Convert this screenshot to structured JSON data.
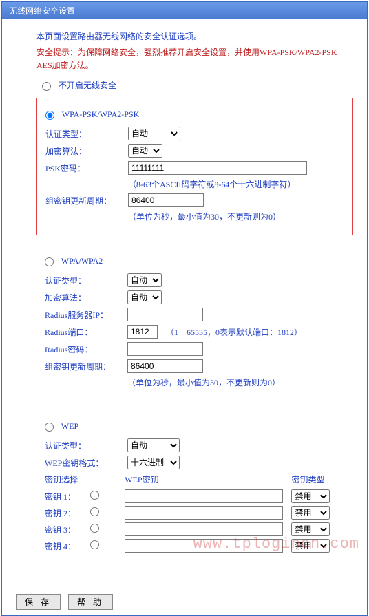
{
  "title": "无线网络安全设置",
  "intro": "本页面设置路由器无线网络的安全认证选项。",
  "warning": "安全提示：为保障网络安全，强烈推荐开启安全设置，并使用WPA-PSK/WPA2-PSK AES加密方法。",
  "disable_label": "不开启无线安全",
  "wpa_psk": {
    "title": "WPA-PSK/WPA2-PSK",
    "auth_label": "认证类型：",
    "auth_value": "自动",
    "enc_label": "加密算法：",
    "enc_value": "自动",
    "psk_label": "PSK密码：",
    "psk_value": "11111111",
    "psk_hint": "（8-63个ASCII码字符或8-64个十六进制字符）",
    "rekey_label": "组密钥更新周期：",
    "rekey_value": "86400",
    "rekey_hint": "（单位为秒，最小值为30，不更新则为0）"
  },
  "wpa": {
    "title": "WPA/WPA2",
    "auth_label": "认证类型：",
    "auth_value": "自动",
    "enc_label": "加密算法：",
    "enc_value": "自动",
    "radius_ip_label": "Radius服务器IP：",
    "radius_ip_value": "",
    "radius_port_label": "Radius端口：",
    "radius_port_value": "1812",
    "radius_port_hint": "（1－65535，0表示默认端口：1812）",
    "radius_pw_label": "Radius密码：",
    "radius_pw_value": "",
    "rekey_label": "组密钥更新周期：",
    "rekey_value": "86400",
    "rekey_hint": "（单位为秒，最小值为30，不更新则为0）"
  },
  "wep": {
    "title": "WEP",
    "auth_label": "认证类型：",
    "auth_value": "自动",
    "fmt_label": "WEP密钥格式：",
    "fmt_value": "十六进制",
    "col_select": "密钥选择",
    "col_key": "WEP密钥",
    "col_type": "密钥类型",
    "keys": [
      {
        "label": "密钥 1：",
        "value": "",
        "type": "禁用"
      },
      {
        "label": "密钥 2：",
        "value": "",
        "type": "禁用"
      },
      {
        "label": "密钥 3：",
        "value": "",
        "type": "禁用"
      },
      {
        "label": "密钥 4：",
        "value": "",
        "type": "禁用"
      }
    ]
  },
  "buttons": {
    "save": "保 存",
    "help": "帮 助"
  },
  "watermark": "www.tplogincn.com"
}
